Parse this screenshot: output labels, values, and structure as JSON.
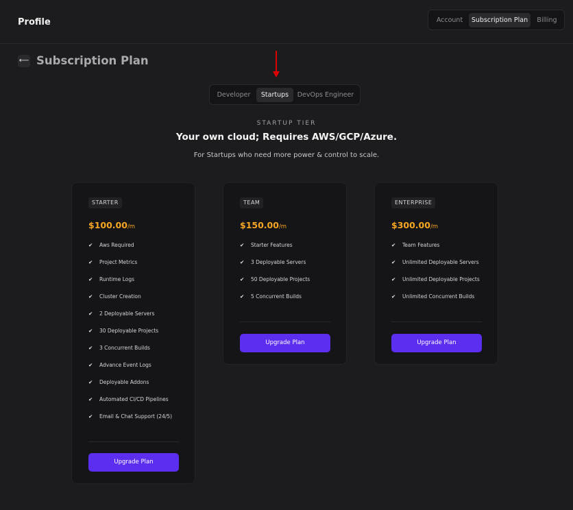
{
  "header": {
    "title": "Profile",
    "tabs": [
      {
        "label": "Account",
        "active": false
      },
      {
        "label": "Subscription Plan",
        "active": true
      },
      {
        "label": "Billing",
        "active": false
      }
    ]
  },
  "page": {
    "back_icon": "arrow-left-icon",
    "title": "Subscription Plan"
  },
  "annotation": {
    "arrow_color": "#e10000"
  },
  "segments": [
    {
      "label": "Developer",
      "active": false
    },
    {
      "label": "Startups",
      "active": true
    },
    {
      "label": "DevOps Engineer",
      "active": false
    }
  ],
  "tier": {
    "label": "STARTUP TIER",
    "heading": "Your own cloud; Requires AWS/GCP/Azure.",
    "subtitle": "For Startups who need more power & control to scale."
  },
  "colors": {
    "accent": "#5b2ef0",
    "price": "#f5a623",
    "background": "#1c1c1e",
    "card": "#151517"
  },
  "plans": [
    {
      "name": "STARTER",
      "price": "$100.00",
      "unit": "/m",
      "features": [
        "Aws Required",
        "Project Metrics",
        "Runtime Logs",
        "Cluster Creation",
        "2 Deployable Servers",
        "30 Deployable Projects",
        "3 Concurrent Builds",
        "Advance Event Logs",
        "Deployable Addons",
        "Automated CI/CD Pipelines",
        "Email & Chat Support (24/5)"
      ],
      "button": "Upgrade Plan"
    },
    {
      "name": "TEAM",
      "price": "$150.00",
      "unit": "/m",
      "features": [
        "Starter Features",
        "3 Deployable Servers",
        "50 Deployable Projects",
        "5 Concurrent Builds"
      ],
      "button": "Upgrade Plan"
    },
    {
      "name": "ENTERPRISE",
      "price": "$300.00",
      "unit": "/m",
      "features": [
        "Team Features",
        "Unlimited Deployable Servers",
        "Unlimited Deployable Projects",
        "Unlimited Concurrent Builds"
      ],
      "button": "Upgrade Plan"
    }
  ],
  "check_icon": "check-icon",
  "check_glyph": "✔"
}
